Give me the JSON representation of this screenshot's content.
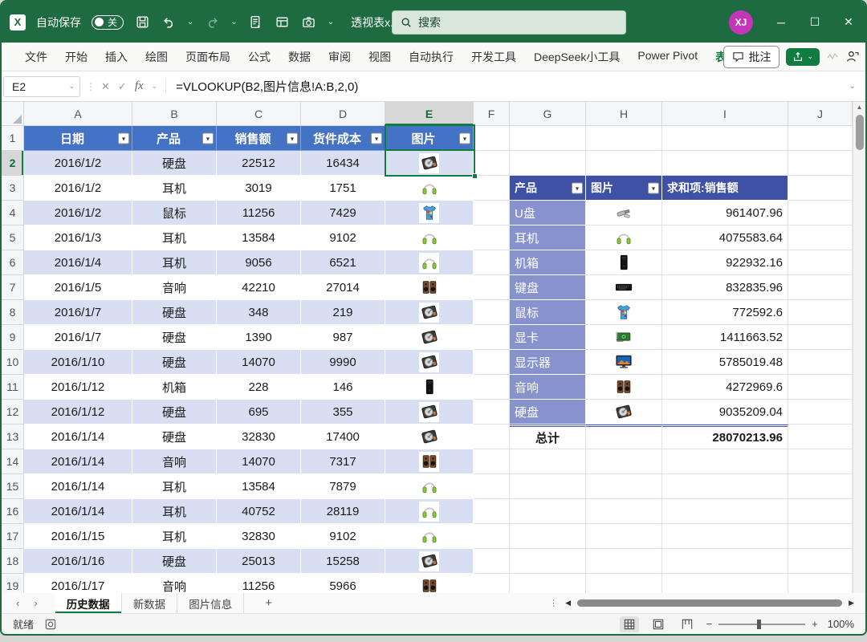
{
  "colors": {
    "titlebar_green": "#1E6B41",
    "accent_green": "#107C41",
    "table_header_blue": "#4472C4",
    "band_blue": "#D8DFF2",
    "pivot_header_blue": "#3F51A5",
    "pivot_label_blue": "#8893CE",
    "avatar_magenta": "#C435B8"
  },
  "titlebar": {
    "autosave_label": "自动保存",
    "autosave_state": "关",
    "filename": "透视表x...",
    "search_placeholder": "搜索",
    "avatar_initials": "XJ"
  },
  "ribbon": {
    "tabs": [
      "文件",
      "开始",
      "插入",
      "绘图",
      "页面布局",
      "公式",
      "数据",
      "审阅",
      "视图",
      "自动执行",
      "开发工具",
      "DeepSeek小工具",
      "Power Pivot"
    ],
    "contextual_tab": "表设计",
    "comments_label": "批注"
  },
  "formula_bar": {
    "name_box": "E2",
    "formula": "=VLOOKUP(B2,图片信息!A:B,2,0)"
  },
  "grid": {
    "column_letters": [
      "A",
      "B",
      "C",
      "D",
      "E",
      "F",
      "G",
      "H",
      "I",
      "J"
    ],
    "selected_column": "E",
    "selected_row": "2",
    "visible_rows": 19
  },
  "table": {
    "headers": [
      "日期",
      "产品",
      "销售额",
      "货件成本",
      "图片"
    ],
    "rows": [
      [
        "2016/1/2",
        "硬盘",
        "22512",
        "16434",
        "hdd-icon"
      ],
      [
        "2016/1/2",
        "耳机",
        "3019",
        "1751",
        "headphones-icon"
      ],
      [
        "2016/1/2",
        "鼠标",
        "11256",
        "7429",
        "tshirt-icon"
      ],
      [
        "2016/1/3",
        "耳机",
        "13584",
        "9102",
        "headphones-icon"
      ],
      [
        "2016/1/4",
        "耳机",
        "9056",
        "6521",
        "headphones-icon"
      ],
      [
        "2016/1/5",
        "音响",
        "42210",
        "27014",
        "speakers-icon"
      ],
      [
        "2016/1/7",
        "硬盘",
        "348",
        "219",
        "hdd-icon"
      ],
      [
        "2016/1/7",
        "硬盘",
        "1390",
        "987",
        "hdd-icon"
      ],
      [
        "2016/1/10",
        "硬盘",
        "14070",
        "9990",
        "hdd-icon"
      ],
      [
        "2016/1/12",
        "机箱",
        "228",
        "146",
        "case-icon"
      ],
      [
        "2016/1/12",
        "硬盘",
        "695",
        "355",
        "hdd-icon"
      ],
      [
        "2016/1/14",
        "硬盘",
        "32830",
        "17400",
        "hdd-icon"
      ],
      [
        "2016/1/14",
        "音响",
        "14070",
        "7317",
        "speakers-icon"
      ],
      [
        "2016/1/14",
        "耳机",
        "13584",
        "7879",
        "headphones-icon"
      ],
      [
        "2016/1/14",
        "耳机",
        "40752",
        "28119",
        "headphones-icon"
      ],
      [
        "2016/1/15",
        "耳机",
        "32830",
        "9102",
        "headphones-icon"
      ],
      [
        "2016/1/16",
        "硬盘",
        "25013",
        "15258",
        "hdd-icon"
      ],
      [
        "2016/1/17",
        "音响",
        "11256",
        "5966",
        "speakers-icon"
      ]
    ]
  },
  "pivot": {
    "headers": [
      "产品",
      "图片",
      "求和项:销售额"
    ],
    "rows": [
      [
        "U盘",
        "usb-icon",
        "961407.96"
      ],
      [
        "耳机",
        "headphones-icon",
        "4075583.64"
      ],
      [
        "机箱",
        "case-icon",
        "922932.16"
      ],
      [
        "键盘",
        "keyboard-icon",
        "832835.96"
      ],
      [
        "鼠标",
        "tshirt-icon",
        "772592.6"
      ],
      [
        "显卡",
        "gpu-icon",
        "1411663.52"
      ],
      [
        "显示器",
        "monitor-icon",
        "5785019.48"
      ],
      [
        "音响",
        "speakers-icon",
        "4272969.6"
      ],
      [
        "硬盘",
        "hdd-icon",
        "9035209.04"
      ]
    ],
    "total_label": "总计",
    "total_value": "28070213.96"
  },
  "sheet_bar": {
    "tabs": [
      "历史数据",
      "新数据",
      "图片信息"
    ],
    "active_tab": "历史数据",
    "add_sheet_label": "+"
  },
  "status_bar": {
    "ready_label": "就绪",
    "zoom_level": "100%"
  }
}
